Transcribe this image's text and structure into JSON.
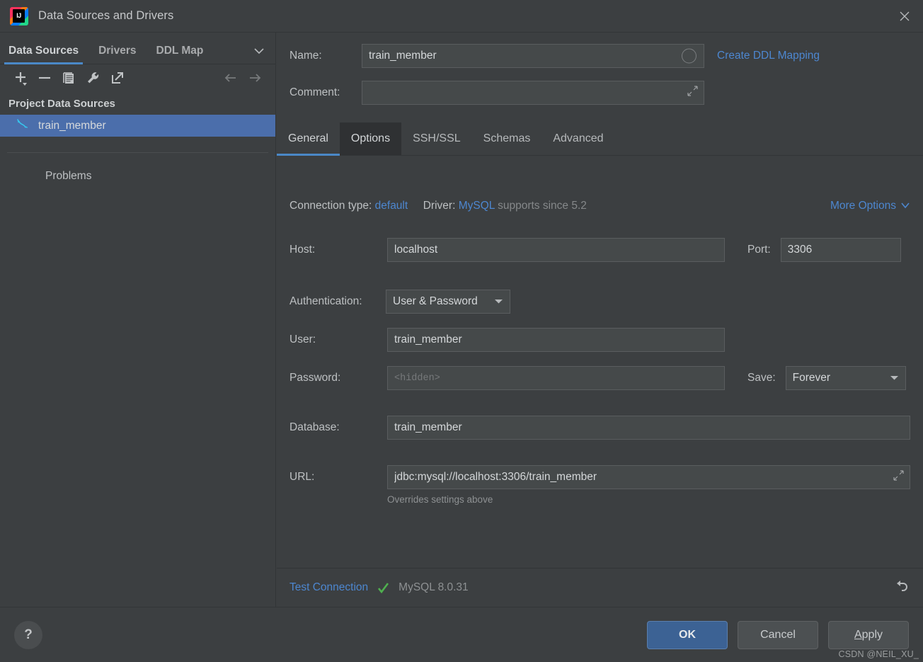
{
  "window": {
    "title": "Data Sources and Drivers",
    "logo_text": "IJ",
    "close_icon": "close-icon"
  },
  "sidebar": {
    "tabs": [
      {
        "label": "Data Sources",
        "active": true
      },
      {
        "label": "Drivers",
        "active": false
      },
      {
        "label": "DDL Map",
        "active": false
      }
    ],
    "toolbar_icons": [
      "add-icon",
      "remove-icon",
      "duplicate-icon",
      "wrench-icon",
      "export-icon",
      "back-arrow-icon",
      "forward-arrow-icon"
    ],
    "group_title": "Project Data Sources",
    "items": [
      {
        "label": "train_member",
        "icon": "mysql-dolphin-icon",
        "selected": true
      }
    ],
    "problems_label": "Problems"
  },
  "form": {
    "name_label": "Name:",
    "name_value": "train_member",
    "comment_label": "Comment:",
    "comment_value": "",
    "comment_placeholder": "",
    "create_ddl_mapping": "Create DDL Mapping"
  },
  "content_tabs": [
    {
      "label": "General",
      "state": "active"
    },
    {
      "label": "Options",
      "state": "hover"
    },
    {
      "label": "SSH/SSL",
      "state": "normal"
    },
    {
      "label": "Schemas",
      "state": "normal"
    },
    {
      "label": "Advanced",
      "state": "normal"
    }
  ],
  "connection": {
    "type_label": "Connection type:",
    "type_value": "default",
    "driver_label": "Driver:",
    "driver_value": "MySQL",
    "driver_suffix": "supports since 5.2",
    "more_options": "More Options"
  },
  "fields": {
    "host_label": "Host:",
    "host_value": "localhost",
    "port_label": "Port:",
    "port_value": "3306",
    "auth_label": "Authentication:",
    "auth_value": "User & Password",
    "user_label": "User:",
    "user_value": "train_member",
    "password_label": "Password:",
    "password_value": "",
    "password_placeholder": "<hidden>",
    "save_label": "Save:",
    "save_value": "Forever",
    "database_label": "Database:",
    "database_value": "train_member",
    "url_label": "URL:",
    "url_value": "jdbc:mysql://localhost:3306/train_member",
    "url_hint": "Overrides settings above"
  },
  "status": {
    "test_connection": "Test Connection",
    "check_icon": "check-icon",
    "version": "MySQL 8.0.31",
    "revert_icon": "revert-icon"
  },
  "bottom": {
    "help_label": "?",
    "ok_label": "OK",
    "cancel_label": "Cancel",
    "apply_label": "Apply",
    "apply_mnemonic": "A"
  },
  "watermark": "CSDN @NEIL_XU_",
  "colors": {
    "background": "#3c3f41",
    "field_bg": "#45494a",
    "selection": "#4b6eab",
    "accent_link": "#4d87d0",
    "tab_underline": "#4a88c7",
    "primary_button": "#3c6294",
    "success_check": "#4fb04f"
  }
}
